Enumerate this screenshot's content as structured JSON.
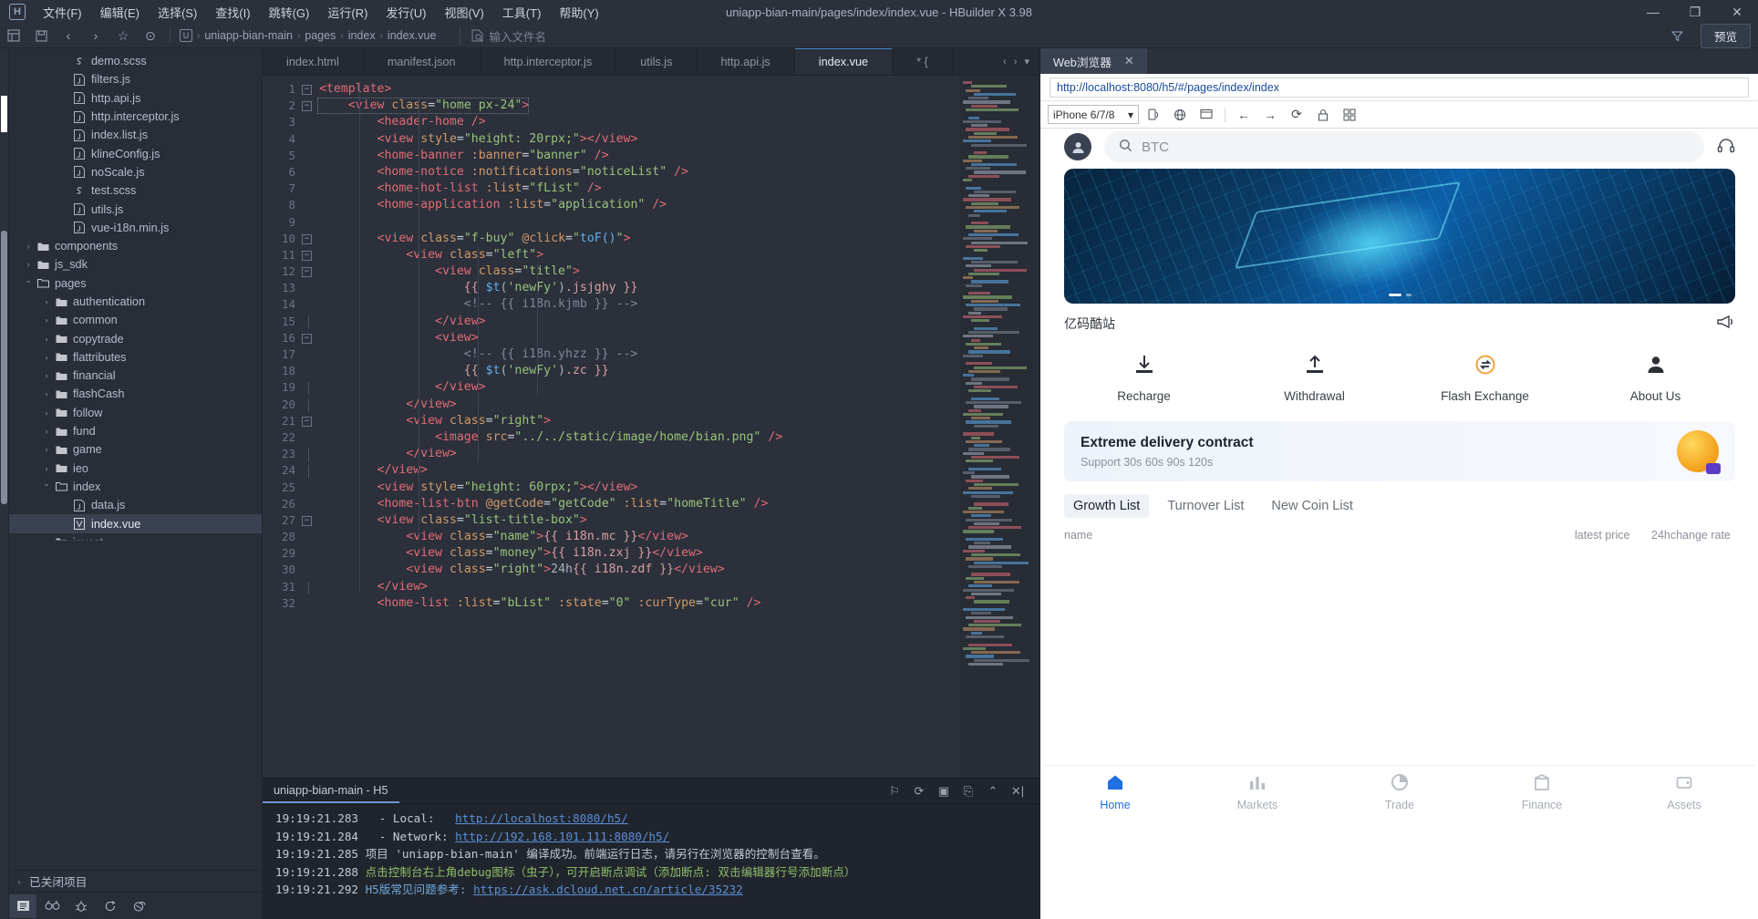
{
  "titlebar": {
    "logo": "H",
    "title": "uniapp-bian-main/pages/index/index.vue - HBuilder X 3.98",
    "menus": [
      "文件(F)",
      "编辑(E)",
      "选择(S)",
      "查找(I)",
      "跳转(G)",
      "运行(R)",
      "发行(U)",
      "视图(V)",
      "工具(T)",
      "帮助(Y)"
    ],
    "window_buttons": {
      "minimize": "—",
      "maximize": "❐",
      "close": "✕"
    }
  },
  "toolbar": {
    "icons": [
      "layout-icon",
      "save-icon",
      "back-arrow-icon",
      "forward-arrow-icon",
      "star-icon",
      "run-icon"
    ],
    "breadcrumb": [
      "uniapp-bian-main",
      "pages",
      "index",
      "index.vue"
    ],
    "file_search_placeholder": "输入文件名",
    "filter_icon": "filter-icon",
    "preview_label": "预览"
  },
  "sidebar": {
    "tree": [
      {
        "label": "demo.scss",
        "depth": 3,
        "icon": "scss",
        "chev": ""
      },
      {
        "label": "filters.js",
        "depth": 3,
        "icon": "js",
        "chev": ""
      },
      {
        "label": "http.api.js",
        "depth": 3,
        "icon": "js",
        "chev": ""
      },
      {
        "label": "http.interceptor.js",
        "depth": 3,
        "icon": "js",
        "chev": ""
      },
      {
        "label": "index.list.js",
        "depth": 3,
        "icon": "js",
        "chev": ""
      },
      {
        "label": "klineConfig.js",
        "depth": 3,
        "icon": "js",
        "chev": ""
      },
      {
        "label": "noScale.js",
        "depth": 3,
        "icon": "js",
        "chev": ""
      },
      {
        "label": "test.scss",
        "depth": 3,
        "icon": "scss",
        "chev": ""
      },
      {
        "label": "utils.js",
        "depth": 3,
        "icon": "js",
        "chev": ""
      },
      {
        "label": "vue-i18n.min.js",
        "depth": 3,
        "icon": "js",
        "chev": ""
      },
      {
        "label": "components",
        "depth": 1,
        "icon": "folder",
        "chev": "closed"
      },
      {
        "label": "js_sdk",
        "depth": 1,
        "icon": "folder",
        "chev": "closed"
      },
      {
        "label": "pages",
        "depth": 1,
        "icon": "folder-open",
        "chev": "open"
      },
      {
        "label": "authentication",
        "depth": 2,
        "icon": "folder",
        "chev": "closed"
      },
      {
        "label": "common",
        "depth": 2,
        "icon": "folder",
        "chev": "closed"
      },
      {
        "label": "copytrade",
        "depth": 2,
        "icon": "folder",
        "chev": "closed"
      },
      {
        "label": "flattributes",
        "depth": 2,
        "icon": "folder",
        "chev": "closed"
      },
      {
        "label": "financial",
        "depth": 2,
        "icon": "folder",
        "chev": "closed"
      },
      {
        "label": "flashCash",
        "depth": 2,
        "icon": "folder",
        "chev": "closed"
      },
      {
        "label": "follow",
        "depth": 2,
        "icon": "folder",
        "chev": "closed"
      },
      {
        "label": "fund",
        "depth": 2,
        "icon": "folder",
        "chev": "closed"
      },
      {
        "label": "game",
        "depth": 2,
        "icon": "folder",
        "chev": "closed"
      },
      {
        "label": "ieo",
        "depth": 2,
        "icon": "folder",
        "chev": "closed"
      },
      {
        "label": "index",
        "depth": 2,
        "icon": "folder-open",
        "chev": "open"
      },
      {
        "label": "data.js",
        "depth": 3,
        "icon": "js",
        "chev": ""
      },
      {
        "label": "index.vue",
        "depth": 3,
        "icon": "vue",
        "chev": "",
        "selected": true
      },
      {
        "label": "invest",
        "depth": 2,
        "icon": "folder",
        "chev": "closed",
        "clipped": true
      }
    ],
    "closed_projects": "已关闭项目",
    "tools": [
      "files-icon",
      "search-icon",
      "debug-icon",
      "git-icon",
      "cloud-icon"
    ]
  },
  "editor": {
    "tabs": [
      {
        "label": "index.html",
        "active": false
      },
      {
        "label": "manifest.json",
        "active": false
      },
      {
        "label": "http.interceptor.js",
        "active": false
      },
      {
        "label": "utils.js",
        "active": false
      },
      {
        "label": "http.api.js",
        "active": false
      },
      {
        "label": "index.vue",
        "active": true
      },
      {
        "label": "* {",
        "active": false
      }
    ],
    "tab_nav": [
      "‹",
      "›",
      "▾"
    ],
    "lines": [
      {
        "n": 1,
        "fold": "minus",
        "html": "<span class='tag'>&lt;template&gt;</span>"
      },
      {
        "n": 2,
        "fold": "minus",
        "html": "    <span class='tag'>&lt;view</span> <span class='attr'>class</span>=<span class='str'>\"home px-24\"</span><span class='tag'>&gt;</span>"
      },
      {
        "n": 3,
        "fold": "",
        "html": "        <span class='tag'>&lt;header-home</span> <span class='tag'>/&gt;</span>"
      },
      {
        "n": 4,
        "fold": "",
        "html": "        <span class='tag'>&lt;view</span> <span class='attr'>style</span>=<span class='str'>\"height: 20rpx;\"</span><span class='tag'>&gt;&lt;/view&gt;</span>"
      },
      {
        "n": 5,
        "fold": "",
        "html": "        <span class='tag'>&lt;home-banner</span> <span class='attr'>:banner</span>=<span class='str'>\"banner\"</span> <span class='tag'>/&gt;</span>"
      },
      {
        "n": 6,
        "fold": "",
        "html": "        <span class='tag'>&lt;home-notice</span> <span class='attr'>:notifications</span>=<span class='str'>\"noticeList\"</span> <span class='tag'>/&gt;</span>"
      },
      {
        "n": 7,
        "fold": "",
        "html": "        <span class='tag'>&lt;home-hot-list</span> <span class='attr'>:list</span>=<span class='str'>\"fList\"</span> <span class='tag'>/&gt;</span>"
      },
      {
        "n": 8,
        "fold": "",
        "html": "        <span class='tag'>&lt;home-application</span> <span class='attr'>:list</span>=<span class='str'>\"application\"</span> <span class='tag'>/&gt;</span>"
      },
      {
        "n": 9,
        "fold": "",
        "html": ""
      },
      {
        "n": 10,
        "fold": "minus",
        "html": "        <span class='tag'>&lt;view</span> <span class='attr'>class</span>=<span class='str'>\"f-buy\"</span> <span class='attr'>@click</span>=<span class='str'>\"</span><span class='fn'>toF()</span><span class='str'>\"</span><span class='tag'>&gt;</span>"
      },
      {
        "n": 11,
        "fold": "minus",
        "html": "            <span class='tag'>&lt;view</span> <span class='attr'>class</span>=<span class='str'>\"left\"</span><span class='tag'>&gt;</span>"
      },
      {
        "n": 12,
        "fold": "minus",
        "html": "                <span class='tag'>&lt;view</span> <span class='attr'>class</span>=<span class='str'>\"title\"</span><span class='tag'>&gt;</span>"
      },
      {
        "n": 13,
        "fold": "",
        "html": "                    <span class='mus'>{{ </span><span class='fn'>$t</span><span class='pun'>(</span><span class='str'>'newFy'</span><span class='pun'>)</span><span class='mus'>.jsjghy }}</span>"
      },
      {
        "n": 14,
        "fold": "",
        "html": "                    <span class='cmt'>&lt;!-- {{ i18n.kjmb }} --&gt;</span>"
      },
      {
        "n": 15,
        "fold": "line",
        "html": "                <span class='tag'>&lt;/view&gt;</span>"
      },
      {
        "n": 16,
        "fold": "minus",
        "html": "                <span class='tag'>&lt;view&gt;</span>"
      },
      {
        "n": 17,
        "fold": "",
        "html": "                    <span class='cmt'>&lt;!-- {{ i18n.yhzz }} --&gt;</span>"
      },
      {
        "n": 18,
        "fold": "",
        "html": "                    <span class='mus'>{{ </span><span class='fn'>$t</span><span class='pun'>(</span><span class='str'>'newFy'</span><span class='pun'>)</span><span class='mus'>.zc }}</span>"
      },
      {
        "n": 19,
        "fold": "line",
        "html": "                <span class='tag'>&lt;/view&gt;</span>"
      },
      {
        "n": 20,
        "fold": "line",
        "html": "            <span class='tag'>&lt;/view&gt;</span>"
      },
      {
        "n": 21,
        "fold": "minus",
        "html": "            <span class='tag'>&lt;view</span> <span class='attr'>class</span>=<span class='str'>\"right\"</span><span class='tag'>&gt;</span>"
      },
      {
        "n": 22,
        "fold": "",
        "html": "                <span class='tag'>&lt;image</span> <span class='attr'>src</span>=<span class='str'>\"../../static/image/home/bian.png\"</span> <span class='tag'>/&gt;</span>"
      },
      {
        "n": 23,
        "fold": "line",
        "html": "            <span class='tag'>&lt;/view&gt;</span>"
      },
      {
        "n": 24,
        "fold": "line",
        "html": "        <span class='tag'>&lt;/view&gt;</span>"
      },
      {
        "n": 25,
        "fold": "",
        "html": "        <span class='tag'>&lt;view</span> <span class='attr'>style</span>=<span class='str'>\"height: 60rpx;\"</span><span class='tag'>&gt;&lt;/view&gt;</span>"
      },
      {
        "n": 26,
        "fold": "",
        "html": "        <span class='tag'>&lt;home-list-btn</span> <span class='attr'>@getCode</span>=<span class='str'>\"getCode\"</span> <span class='attr'>:list</span>=<span class='str'>\"homeTitle\"</span> <span class='tag'>/&gt;</span>"
      },
      {
        "n": 27,
        "fold": "minus",
        "html": "        <span class='tag'>&lt;view</span> <span class='attr'>class</span>=<span class='str'>\"list-title-box\"</span><span class='tag'>&gt;</span>"
      },
      {
        "n": 28,
        "fold": "",
        "html": "            <span class='tag'>&lt;view</span> <span class='attr'>class</span>=<span class='str'>\"name\"</span><span class='tag'>&gt;</span><span class='mus'>{{ i18n.mc }}</span><span class='tag'>&lt;/view&gt;</span>"
      },
      {
        "n": 29,
        "fold": "",
        "html": "            <span class='tag'>&lt;view</span> <span class='attr'>class</span>=<span class='str'>\"money\"</span><span class='tag'>&gt;</span><span class='mus'>{{ i18n.zxj }}</span><span class='tag'>&lt;/view&gt;</span>"
      },
      {
        "n": 30,
        "fold": "",
        "html": "            <span class='tag'>&lt;view</span> <span class='attr'>class</span>=<span class='str'>\"right\"</span><span class='tag'>&gt;</span><span class='pun'>24h</span><span class='mus'>{{ i18n.zdf }}</span><span class='tag'>&lt;/view&gt;</span>"
      },
      {
        "n": 31,
        "fold": "line",
        "html": "        <span class='tag'>&lt;/view&gt;</span>"
      },
      {
        "n": 32,
        "fold": "",
        "html": "        <span class='tag'>&lt;home-list</span> <span class='attr'>:list</span>=<span class='str'>\"bList\"</span> <span class='attr'>:state</span>=<span class='str'>\"0\"</span> <span class='attr'>:curType</span>=<span class='str'>\"cur\"</span> <span class='tag'>/&gt;</span>"
      }
    ]
  },
  "console": {
    "tab_label": "uniapp-bian-main - H5",
    "tools": [
      "pin-icon",
      "clock-icon",
      "stop-icon",
      "export-icon",
      "collapse-icon",
      "clear-icon"
    ],
    "lines": [
      {
        "time": "19:19:21.283",
        "pre": "  - Local:   ",
        "link": "http://localhost:8080/h5/",
        "tail": "",
        "cls": ""
      },
      {
        "time": "19:19:21.284",
        "pre": "  - Network: ",
        "link": "http://192.168.101.111:8080/h5/",
        "tail": "",
        "cls": ""
      },
      {
        "time": "19:19:21.285",
        "pre": "项目 'uniapp-bian-main' 编译成功。前端运行日志，请另行在浏览器的控制台查看。",
        "link": "",
        "tail": "",
        "cls": ""
      },
      {
        "time": "19:19:21.288",
        "pre": "点击控制台右上角debug图标（虫子），可开启断点调试（添加断点: 双击编辑器行号添加断点）",
        "link": "",
        "tail": "",
        "cls": "green"
      },
      {
        "time": "19:19:21.292",
        "pre": "H5版常见问题参考: ",
        "link": "https://ask.dcloud.net.cn/article/35232",
        "tail": "",
        "cls": "blue"
      }
    ]
  },
  "browser": {
    "tab_label": "Web浏览器",
    "tab_close": "✕",
    "url": "http://localhost:8080/h5/#/pages/index/index",
    "device": "iPhone 6/7/8",
    "dev_buttons": [
      "rotate-icon",
      "inspect-icon",
      "responsive-icon",
      "screenshot-icon",
      "back-arrow-icon",
      "forward-arrow-icon",
      "reload-icon",
      "lock-icon",
      "grid-icon"
    ]
  },
  "app": {
    "search_value": "BTC",
    "avatar_icon": "user-avatar-icon",
    "search_icon": "search-icon",
    "headset_icon": "headset-icon",
    "notice_text": "亿码酷站",
    "notice_icon": "megaphone-icon",
    "actions": [
      {
        "label": "Recharge",
        "icon": "download-icon"
      },
      {
        "label": "Withdrawal",
        "icon": "upload-icon"
      },
      {
        "label": "Flash Exchange",
        "icon": "swap-icon"
      },
      {
        "label": "About Us",
        "icon": "person-icon"
      }
    ],
    "promo": {
      "title": "Extreme delivery contract",
      "subtitle": "Support 30s 60s 90s 120s",
      "badge_icon": "medal-icon"
    },
    "list_tabs": [
      {
        "label": "Growth List",
        "active": true
      },
      {
        "label": "Turnover List",
        "active": false
      },
      {
        "label": "New Coin List",
        "active": false
      }
    ],
    "list_headers": [
      "name",
      "latest price",
      "24hchange rate"
    ],
    "bottom_nav": [
      {
        "label": "Home",
        "icon": "home-icon",
        "active": true
      },
      {
        "label": "Markets",
        "icon": "chart-icon",
        "active": false
      },
      {
        "label": "Trade",
        "icon": "pie-icon",
        "active": false
      },
      {
        "label": "Finance",
        "icon": "bank-icon",
        "active": false
      },
      {
        "label": "Assets",
        "icon": "wallet-icon",
        "active": false
      }
    ]
  }
}
